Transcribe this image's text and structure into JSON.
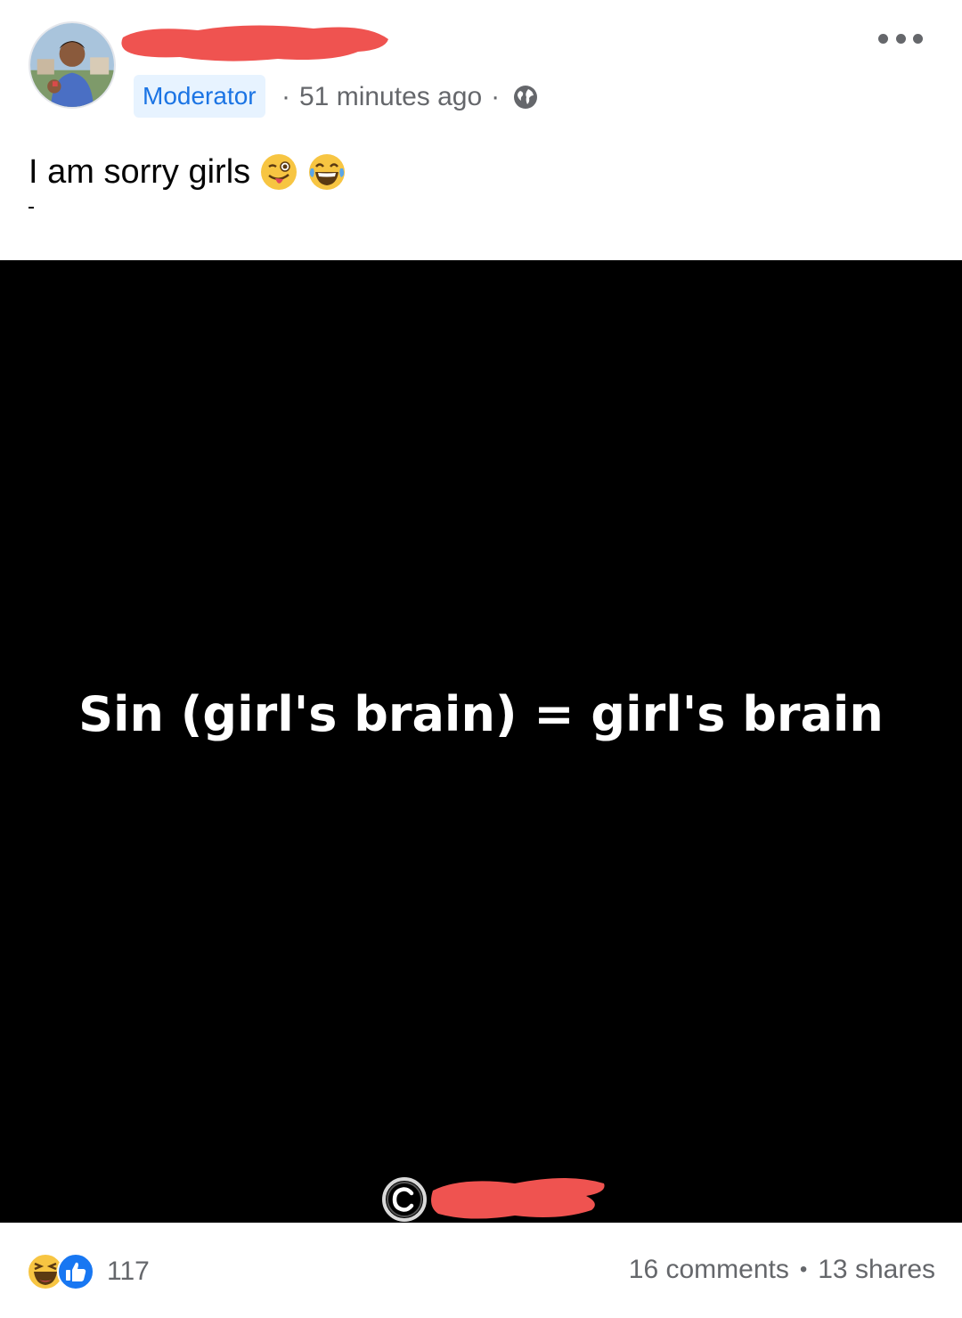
{
  "post": {
    "role_badge": "Moderator",
    "meta_separator": "·",
    "timestamp": "51 minutes ago",
    "privacy_icon": "globe-icon",
    "text": "I am sorry girls",
    "emojis": [
      "winking-tongue-face",
      "tears-of-joy-face"
    ]
  },
  "media": {
    "caption": "Sin (girl's brain) = girl's brain",
    "watermark_icon": "copyright-icon"
  },
  "footer": {
    "reaction_icons": [
      "haha-reaction-icon",
      "like-reaction-icon"
    ],
    "reaction_count": "117",
    "comments": "16 comments",
    "stats_separator": "•",
    "shares": "13 shares"
  },
  "colors": {
    "badge_bg": "#e7f3ff",
    "badge_text": "#1b74e4",
    "meta_text": "#65676b",
    "redaction": "#ef5350",
    "media_bg": "#000000"
  }
}
